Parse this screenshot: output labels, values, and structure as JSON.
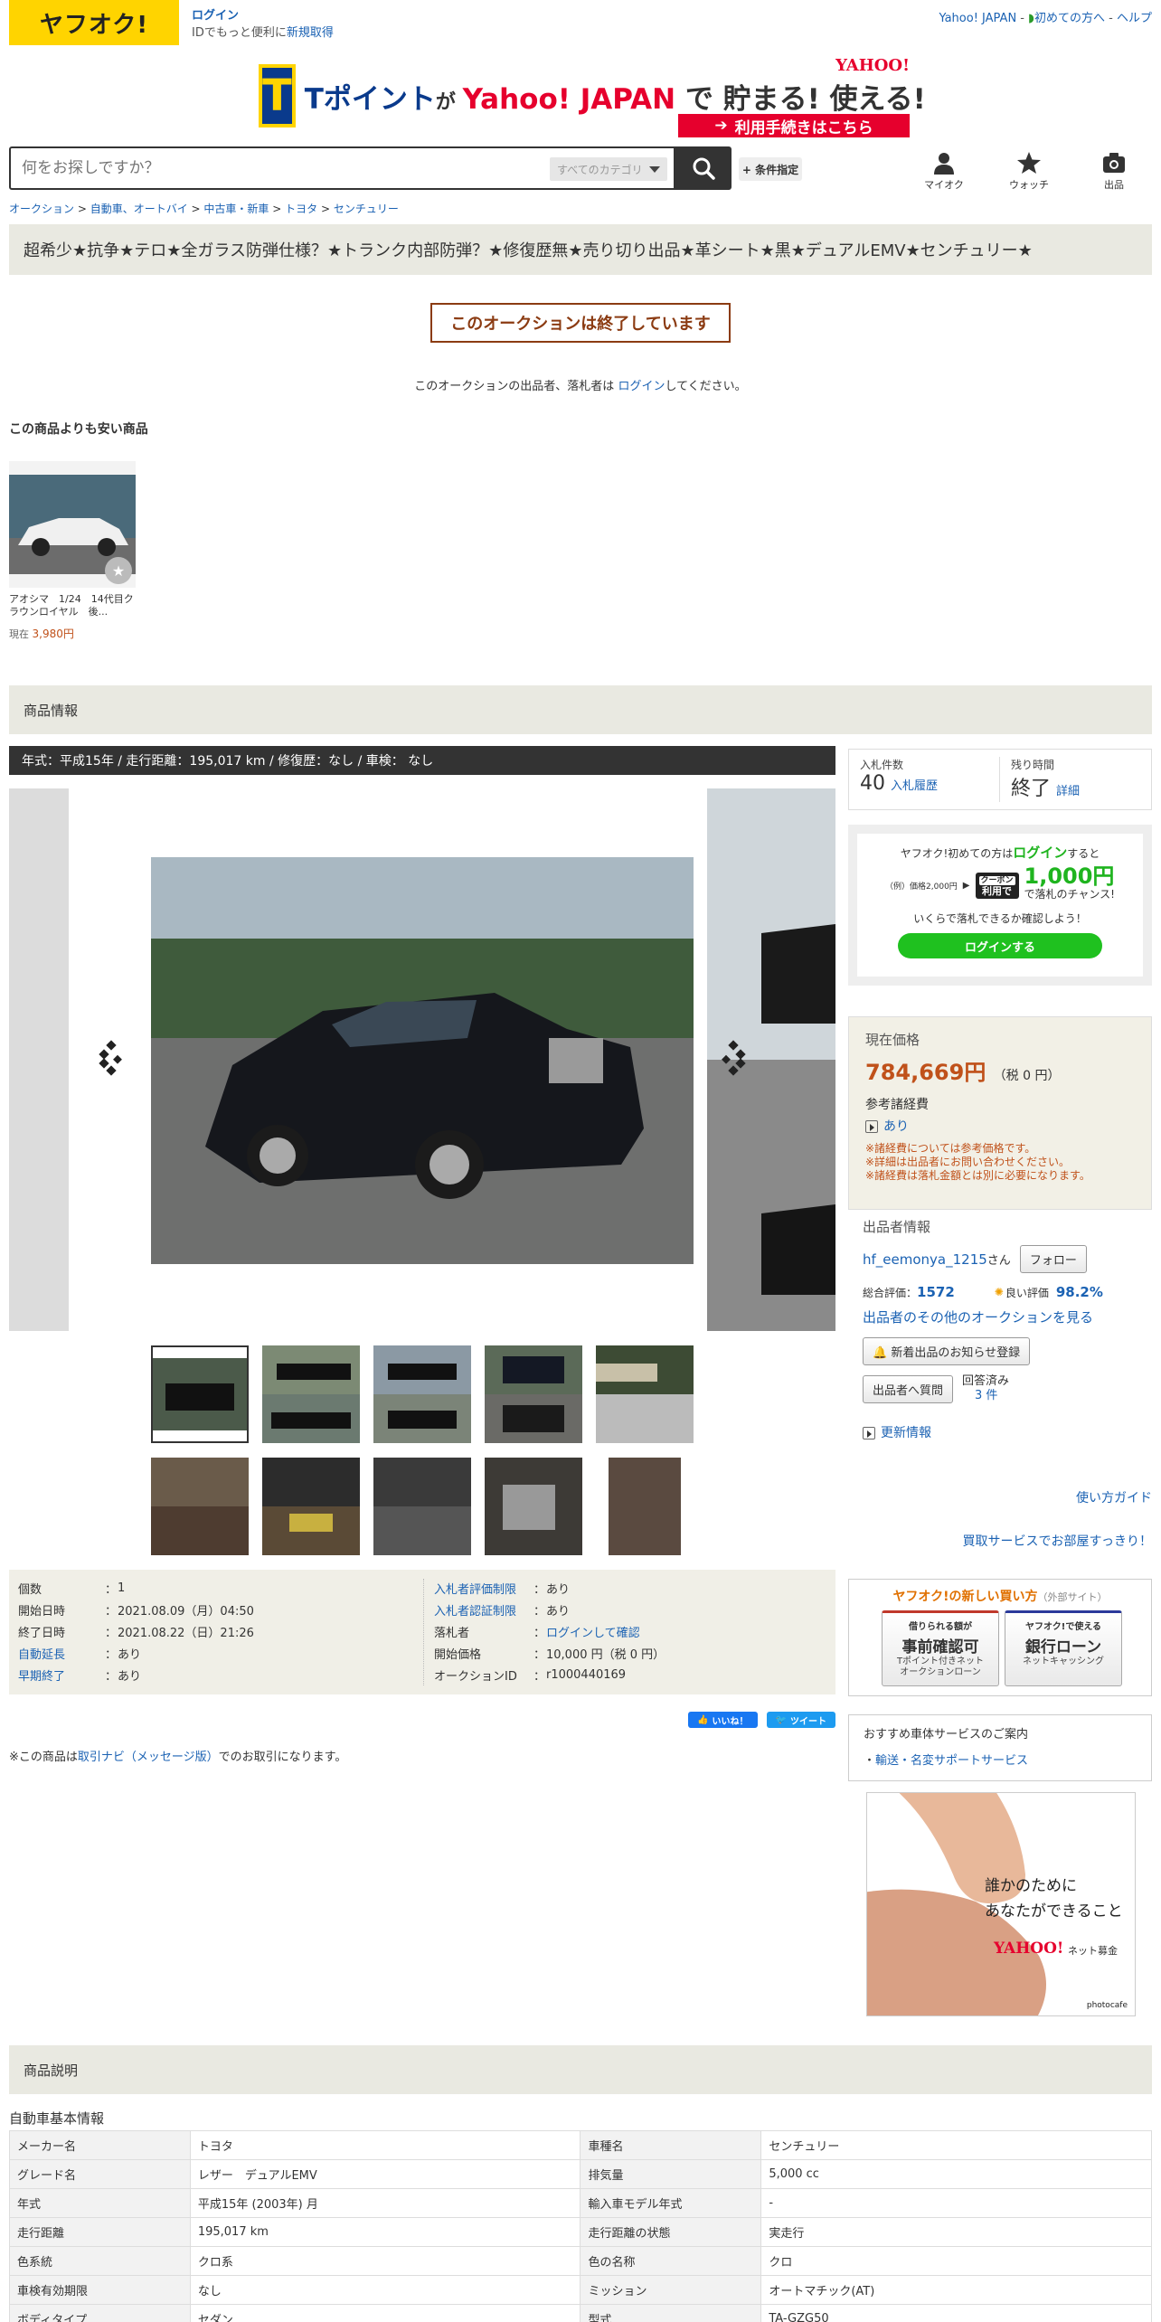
{
  "header": {
    "logo": "ヤフオク!",
    "login": "ログイン",
    "login_sub_prefix": "IDでもっと便利に",
    "register": "新規取得",
    "links": [
      "Yahoo! JAPAN",
      "初めての方へ",
      "ヘルプ"
    ],
    "link_sep": " - "
  },
  "banner": {
    "t_letter": "T",
    "text_a": "Tポイント",
    "text_b": "が ",
    "text_c": "Yahoo! JAPAN",
    "text_d": " で 貯まる! 使える!",
    "yj": "YAHOO!",
    "btn": "利用手続きはこちら"
  },
  "search": {
    "placeholder": "何をお探しですか？",
    "category": "すべてのカテゴリ",
    "condition": "+ 条件指定"
  },
  "nav": {
    "my": "マイオク",
    "watch": "ウォッチ",
    "sell": "出品"
  },
  "breadcrumb": [
    "オークション",
    "自動車、オートバイ",
    "中古車・新車",
    "トヨタ",
    "センチュリー"
  ],
  "breadcrumb_sep": " > ",
  "title": "超希少★抗争★テロ★全ガラス防弾仕様？★トランク内部防弾？★修復歴無★売り切り出品★革シート★黒★デュアルEMV★センチュリー★",
  "ended": "このオークションは終了しています",
  "ended_msg": {
    "a": "このオークションの出品者、落札者は ",
    "link": "ログイン",
    "b": "してください。"
  },
  "cheaper": {
    "title": "この商品よりも安い商品",
    "item_name": "アオシマ　1/24　14代目クラウンロイヤル　後...",
    "price_label": "現在 ",
    "price": "3,980円"
  },
  "section_info": "商品情報",
  "spec": "年式：平成15年 / 走行距離：195,017 km / 修復歴：なし / 車検： なし",
  "bid": {
    "count_label": "入札件数",
    "count": "40",
    "history": "入札履歴",
    "time_label": "残り時間",
    "time": "終了",
    "detail": "詳細"
  },
  "promo": {
    "l1a": "ヤフオク!初めての方は",
    "l1b": "ログイン",
    "l1c": "すると",
    "example": "（例）価格2,000円",
    "coupon": "クーポン",
    "use": "利用で",
    "amount": "1,000円",
    "chance": "で落札のチャンス!",
    "l3": "いくらで落札できるか確認しよう！",
    "btn": "ログインする"
  },
  "price": {
    "label": "現在価格",
    "value": "784,669円",
    "tax": "（税 0 円）",
    "fees_label": "参考諸経費",
    "fees_link": "あり",
    "notes": [
      "※諸経費については参考価格です。",
      "※詳細は出品者にお問い合わせください。",
      "※諸経費は落札金額とは別に必要になります。"
    ]
  },
  "seller": {
    "heading": "出品者情報",
    "name": "hf_eemonya_1215",
    "san": "さん",
    "follow": "フォロー",
    "rating_label": "総合評価：",
    "rating": "1572",
    "good_label": "良い評価",
    "good": "98.2%",
    "other": "出品者のその他のオークションを見る",
    "notify": "新着出品のお知らせ登録",
    "ask": "出品者へ質問",
    "answered_label": "回答済み",
    "answered": "3 件",
    "update": "更新情報"
  },
  "howto": "使い方ガイド",
  "buyback": "買取サービスでお部屋すっきり！",
  "newway": {
    "title": "ヤフオク!の新しい買い方",
    "ext": "（外部サイト）",
    "c1_s": "借りられる額が",
    "c1_b": "事前確認可",
    "c1_x1": "Tポイント付きネット",
    "c1_x2": "オークションローン",
    "c2_s": "ヤフオク!で使える",
    "c2_b": "銀行ローン",
    "c2_x1": "ネットキャッシング"
  },
  "osusume": {
    "title": "おすすめ車体サービスのご案内",
    "link": "輸送・名変サポートサービス"
  },
  "ad": {
    "l1": "誰かのために",
    "l2": "あなたができること",
    "brand": "YAHOO!",
    "sub": "ネット募金",
    "credit": "photocafe"
  },
  "info": {
    "left": [
      {
        "k": "個数",
        "v": "1"
      },
      {
        "k": "開始日時",
        "v": "2021.08.09（月）04:50"
      },
      {
        "k": "終了日時",
        "v": "2021.08.22（日）21:26"
      },
      {
        "k": "自動延長",
        "v": "あり"
      },
      {
        "k": "早期終了",
        "v": "あり"
      }
    ],
    "right": [
      {
        "k": "入札者評価制限",
        "v": "あり"
      },
      {
        "k": "入札者認証制限",
        "v": "あり"
      },
      {
        "k": "落札者",
        "v": "ログインして確認"
      },
      {
        "k": "開始価格",
        "v": "10,000 円（税 0 円）"
      },
      {
        "k": "オークションID",
        "v": "r1000440169"
      }
    ],
    "colon": "："
  },
  "social": {
    "like": "いいね！",
    "tweet": "ツイート"
  },
  "trade": {
    "a": "※この商品は",
    "link": "取引ナビ（メッセージ版）",
    "b": "でのお取引になります。"
  },
  "section_desc": "商品説明",
  "desc_sub": "自動車基本情報",
  "desc_rows": [
    [
      "メーカー名",
      "トヨタ",
      "車種名",
      "センチュリー"
    ],
    [
      "グレード名",
      "レザー　デュアルEMV",
      "排気量",
      "5,000 cc"
    ],
    [
      "年式",
      "平成15年 (2003年) 月",
      "輸入車モデル年式",
      "-"
    ],
    [
      "走行距離",
      "195,017 km",
      "走行距離の状態",
      "実走行"
    ],
    [
      "色系統",
      "クロ系",
      "色の名称",
      "クロ"
    ],
    [
      "車検有効期限",
      "なし",
      "ミッション",
      "オートマチック(AT)"
    ],
    [
      "ボディタイプ",
      "セダン",
      "型式",
      "TA-GZG50"
    ]
  ]
}
